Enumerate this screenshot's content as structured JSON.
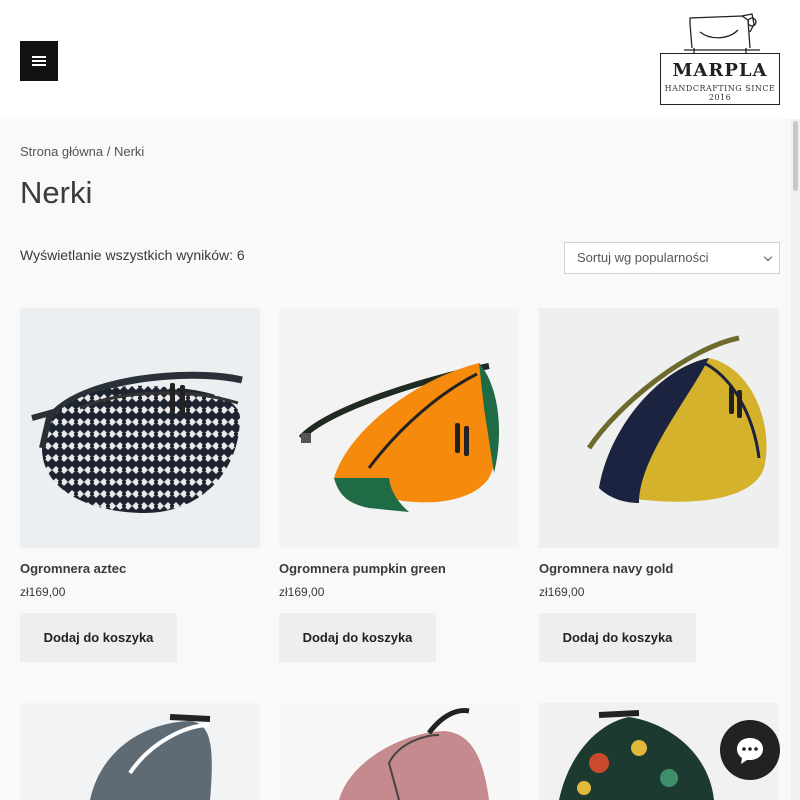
{
  "header": {
    "menu_icon": "hamburger-icon",
    "logo": {
      "name": "MARPLA",
      "tagline": "HANDCRAFTING SINCE 2016"
    }
  },
  "breadcrumb": {
    "home": "Strona główna",
    "separator": " / ",
    "current": "Nerki"
  },
  "page_title": "Nerki",
  "result_count": "Wyświetlanie wszystkich wyników: 6",
  "sort": {
    "selected": "Sortuj wg popularności"
  },
  "products": [
    {
      "name": "Ogromnera aztec",
      "price": "zł169,00",
      "button": "Dodaj do koszyka"
    },
    {
      "name": "Ogromnera pumpkin green",
      "price": "zł169,00",
      "button": "Dodaj do koszyka"
    },
    {
      "name": "Ogromnera navy gold",
      "price": "zł169,00",
      "button": "Dodaj do koszyka"
    }
  ],
  "chat": {
    "icon": "chat-bubble-icon"
  },
  "colors": {
    "accent_dark": "#111111",
    "button_bg": "#eeeeee",
    "page_bg": "#f9f9f9"
  }
}
